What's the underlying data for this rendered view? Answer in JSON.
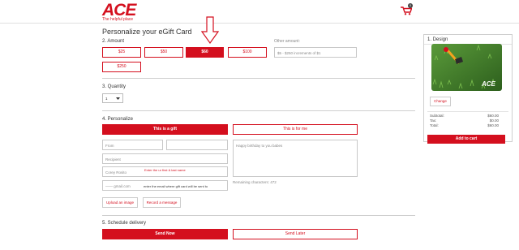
{
  "header": {
    "logo_text": "ACE",
    "logo_tagline": "The helpful place",
    "cart_count": "0"
  },
  "page_title": "Personalize your eGift Card",
  "amount": {
    "label": "2. Amount",
    "options": [
      "$25",
      "$50",
      "$60",
      "$100",
      "$250"
    ],
    "selected": "$60",
    "other_label": "Other amount:",
    "other_placeholder": "$5 - $250 increments of $1"
  },
  "quantity": {
    "label": "3. Quantity",
    "value": "1"
  },
  "personalize": {
    "label": "4. Personalize",
    "tab_gift": "This is a gift",
    "tab_me": "This is for me",
    "first_name_placeholder": "From",
    "last_name_placeholder": "",
    "recipient_placeholder": "Recipient",
    "sender_value": "Corey Rosito",
    "sender_hint": "Enter the ur first & last name",
    "email_value": "—— gmail.com",
    "email_hint": "enter the email where gift card will be sent to",
    "message_value": "Happy birthday to you babes",
    "remaining": "Remaining characters: 472",
    "upload_label": "Upload an image",
    "record_label": "Record a message"
  },
  "delivery": {
    "label": "5. Schedule delivery",
    "send_now": "Send Now",
    "send_later": "Send Later"
  },
  "design": {
    "label": "1. Design",
    "change_label": "Change",
    "card_logo": "ACE",
    "summary": [
      {
        "label": "Subtotal:",
        "value": "$60.00"
      },
      {
        "label": "Tax:",
        "value": "$0.00"
      },
      {
        "label": "Total:",
        "value": "$60.00"
      }
    ],
    "add_to_cart": "Add to cart"
  },
  "colors": {
    "brand_red": "#d40f1e",
    "card_green": "#3f7a2a"
  }
}
